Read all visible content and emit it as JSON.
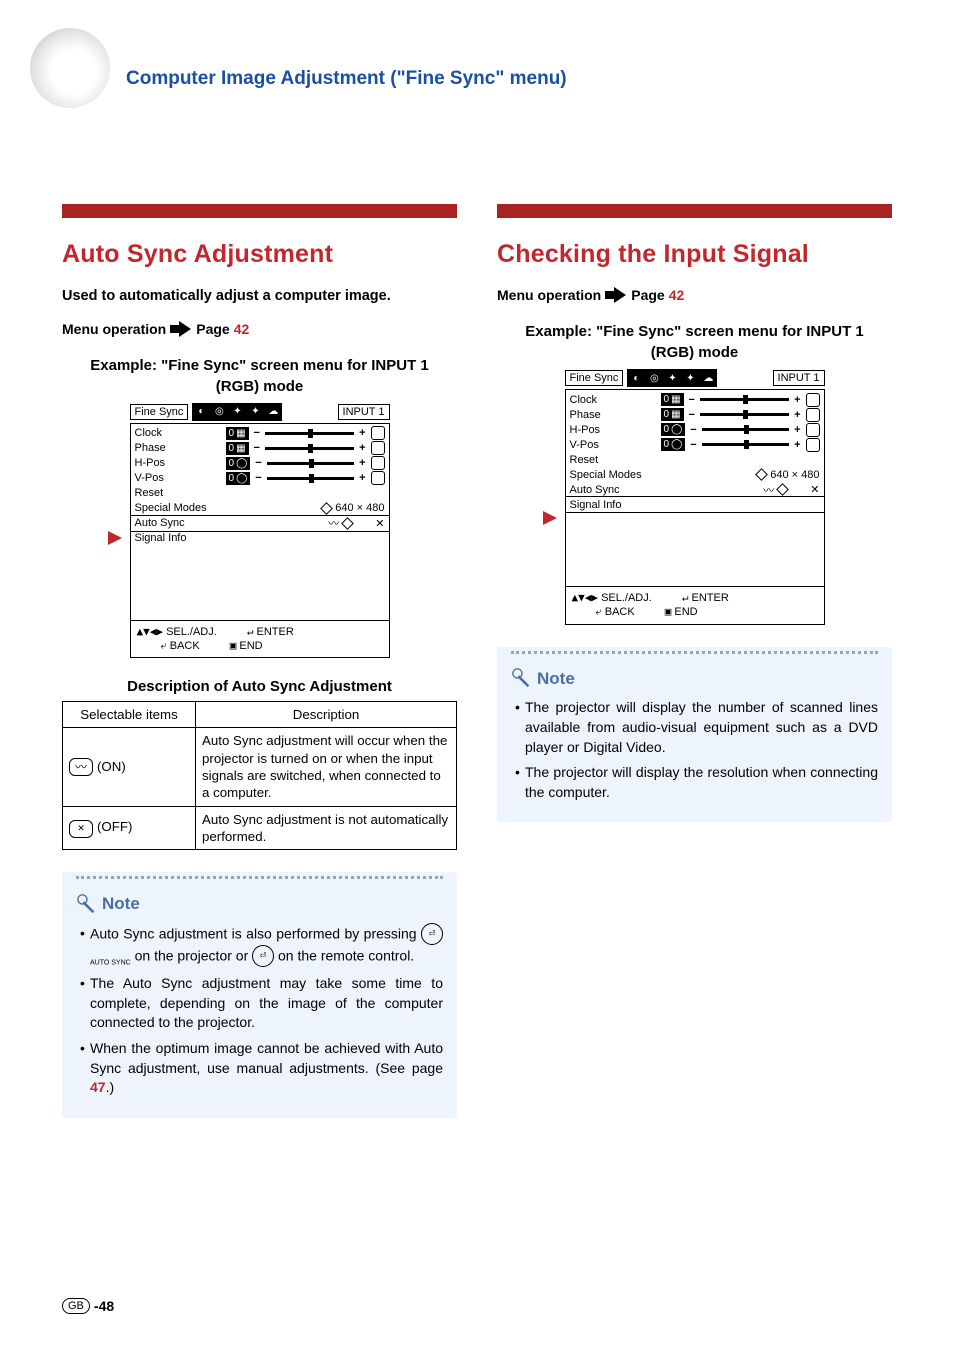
{
  "page_title": "Computer Image Adjustment (\"Fine Sync\" menu)",
  "left": {
    "heading": "Auto Sync Adjustment",
    "intro": "Used to automatically adjust a computer image.",
    "menu_op_label": "Menu operation",
    "menu_op_page_prefix": "Page ",
    "menu_op_page": "42",
    "example_caption": "Example: \"Fine Sync\" screen menu for INPUT 1 (RGB) mode",
    "osd": {
      "tab": "Fine Sync",
      "input_label": "INPUT 1",
      "rows": [
        {
          "label": "Clock",
          "val": "0"
        },
        {
          "label": "Phase",
          "val": "0"
        },
        {
          "label": "H-Pos",
          "val": "0"
        },
        {
          "label": "V-Pos",
          "val": "0"
        }
      ],
      "reset": "Reset",
      "special_modes": "Special Modes",
      "special_modes_val": "640 × 480",
      "auto_sync": "Auto Sync",
      "signal_info": "Signal Info",
      "foot_sel": "SEL./ADJ.",
      "foot_enter": "ENTER",
      "foot_back": "BACK",
      "foot_end": "END",
      "highlight": "auto_sync"
    },
    "desc_title": "Description of Auto Sync Adjustment",
    "table": {
      "h1": "Selectable items",
      "h2": "Description",
      "rows": [
        {
          "item": "(ON)",
          "icon": "on",
          "desc": "Auto Sync adjustment will occur when the projector is turned on or when the input signals are switched, when connected to a computer."
        },
        {
          "item": "(OFF)",
          "icon": "off",
          "desc": "Auto Sync adjustment is not automatically performed."
        }
      ]
    },
    "note": {
      "label": "Note",
      "bullets_pre": "Auto Sync adjustment is also performed by pressing",
      "bullets_mid": "on the projector or",
      "bullets_post": "on the remote control.",
      "btn1_sub": "AUTO SYNC",
      "b2": "The Auto Sync adjustment may take some time to complete, depending on the image of the computer connected to the projector.",
      "b3_pre": "When the optimum image cannot be achieved with Auto Sync adjustment, use manual adjustments. (See page ",
      "b3_page": "47",
      "b3_post": ".)"
    }
  },
  "right": {
    "heading": "Checking the Input Signal",
    "menu_op_label": "Menu operation",
    "menu_op_page_prefix": "Page ",
    "menu_op_page": "42",
    "example_caption": "Example: \"Fine Sync\" screen menu for INPUT 1 (RGB) mode",
    "osd": {
      "tab": "Fine Sync",
      "input_label": "INPUT 1",
      "rows": [
        {
          "label": "Clock",
          "val": "0"
        },
        {
          "label": "Phase",
          "val": "0"
        },
        {
          "label": "H-Pos",
          "val": "0"
        },
        {
          "label": "V-Pos",
          "val": "0"
        }
      ],
      "reset": "Reset",
      "special_modes": "Special Modes",
      "special_modes_val": "640 × 480",
      "auto_sync": "Auto Sync",
      "signal_info": "Signal Info",
      "foot_sel": "SEL./ADJ.",
      "foot_enter": "ENTER",
      "foot_back": "BACK",
      "foot_end": "END",
      "highlight": "signal_info"
    },
    "note": {
      "label": "Note",
      "b1": "The projector will display the number of scanned lines available from audio-visual equipment such as a DVD player or Digital Video.",
      "b2": "The projector will display the resolution when connecting the computer."
    }
  },
  "footer": {
    "gb": "GB",
    "num": "-48"
  },
  "chart_data": {
    "type": "table",
    "title": "Description of Auto Sync Adjustment",
    "categories": [
      "Selectable items",
      "Description"
    ],
    "series": [
      {
        "name": "ON",
        "values": [
          "(ON)",
          "Auto Sync adjustment will occur when the projector is turned on or when the input signals are switched, when connected to a computer."
        ]
      },
      {
        "name": "OFF",
        "values": [
          "(OFF)",
          "Auto Sync adjustment is not automatically performed."
        ]
      }
    ]
  }
}
